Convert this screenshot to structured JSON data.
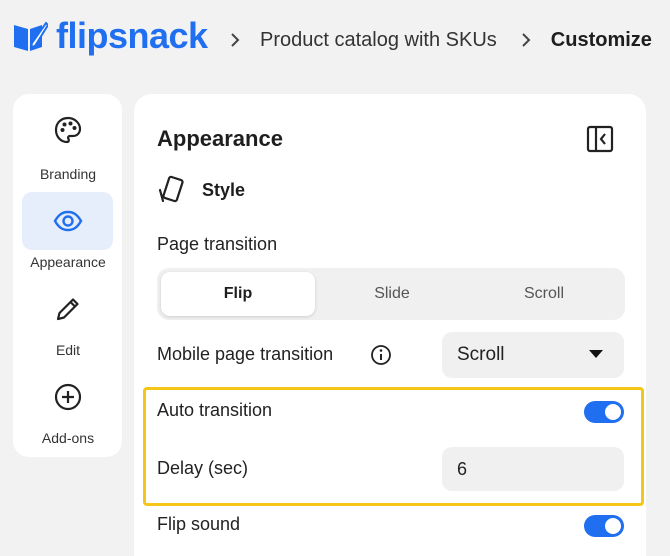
{
  "brand": {
    "name": "flipsnack",
    "color": "#1f6ff0"
  },
  "breadcrumbs": [
    "Product catalog with SKUs",
    "Customize"
  ],
  "rail": {
    "items": [
      {
        "label": "Branding",
        "icon": "palette-icon",
        "active": false
      },
      {
        "label": "Appearance",
        "icon": "eye-icon",
        "active": true
      },
      {
        "label": "Edit",
        "icon": "pencil-icon",
        "active": false
      },
      {
        "label": "Add-ons",
        "icon": "plus-circle-icon",
        "active": false
      }
    ]
  },
  "panel": {
    "title": "Appearance",
    "section": "Style",
    "page_transition": {
      "label": "Page transition",
      "options": [
        "Flip",
        "Slide",
        "Scroll"
      ],
      "selected": "Flip"
    },
    "mobile_transition": {
      "label": "Mobile page transition",
      "value": "Scroll"
    },
    "auto_transition": {
      "label": "Auto transition",
      "enabled": true
    },
    "delay": {
      "label": "Delay (sec)",
      "value": "6"
    },
    "flip_sound": {
      "label": "Flip sound",
      "enabled": true
    }
  },
  "colors": {
    "accent": "#1f6ff0",
    "highlight": "#f5c518",
    "active_bg": "#e6eefb"
  }
}
